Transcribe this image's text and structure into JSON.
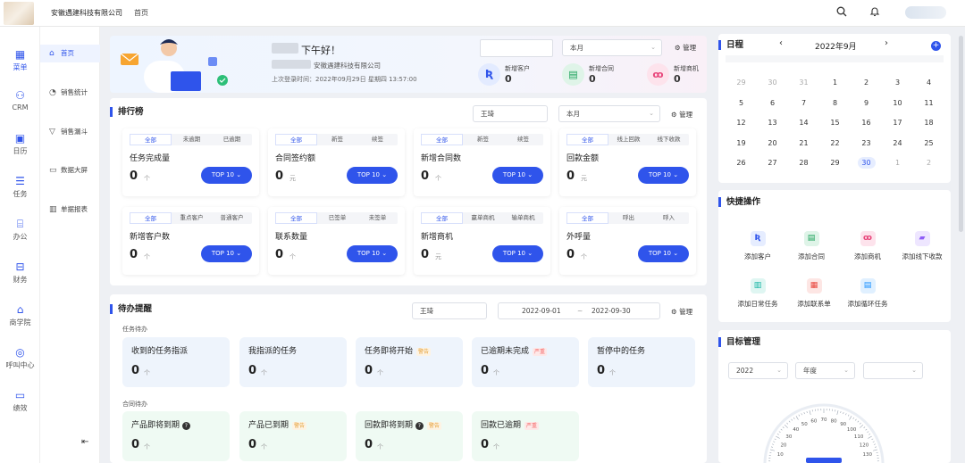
{
  "header": {
    "company": "安徽遇建科技有限公司",
    "breadcrumb": "首页"
  },
  "nav_primary": [
    {
      "label": "菜单",
      "icon": "grid-icon",
      "active": true
    },
    {
      "label": "CRM",
      "icon": "users-icon"
    },
    {
      "label": "日历",
      "icon": "calendar-icon"
    },
    {
      "label": "任务",
      "icon": "task-icon"
    },
    {
      "label": "办公",
      "icon": "office-icon"
    },
    {
      "label": "财务",
      "icon": "finance-icon"
    },
    {
      "label": "商学院",
      "icon": "academy-icon"
    },
    {
      "label": "呼叫中心",
      "icon": "callcenter-icon"
    },
    {
      "label": "绩效",
      "icon": "performance-icon"
    }
  ],
  "nav_secondary": [
    {
      "label": "首页",
      "icon": "home-icon",
      "active": true
    },
    {
      "label": "销售统计",
      "icon": "stats-icon"
    },
    {
      "label": "销售漏斗",
      "icon": "funnel-icon"
    },
    {
      "label": "数据大屏",
      "icon": "screen-icon"
    },
    {
      "label": "单据报表",
      "icon": "report-icon"
    }
  ],
  "welcome": {
    "greeting": "下午好！",
    "company": "安徽遇建科技有限公司",
    "last_login": "上次登录时间：2022年09月29日 星期四 13:57:00",
    "period": "本月",
    "manage": "管理",
    "stats": [
      {
        "label": "新增客户",
        "value": "0",
        "icon": "customer-icon",
        "color": "#2f54eb",
        "bg": "#e3ebff"
      },
      {
        "label": "新增合同",
        "value": "0",
        "icon": "contract-icon",
        "color": "#18a058",
        "bg": "#dff4e8"
      },
      {
        "label": "新增商机",
        "value": "0",
        "icon": "opportunity-icon",
        "color": "#e8457a",
        "bg": "#fde3ec"
      }
    ]
  },
  "ranking": {
    "title": "排行榜",
    "person": "王琦",
    "period": "本月",
    "manage": "管理",
    "top_label": "TOP 10",
    "cards": [
      {
        "tabs": [
          "全部",
          "未逾期",
          "已逾期"
        ],
        "title": "任务完成量",
        "value": "0",
        "unit": "个"
      },
      {
        "tabs": [
          "全部",
          "新签",
          "续签"
        ],
        "title": "合同签约额",
        "value": "0",
        "unit": "元"
      },
      {
        "tabs": [
          "全部",
          "新签",
          "续签"
        ],
        "title": "新增合同数",
        "value": "0",
        "unit": "个"
      },
      {
        "tabs": [
          "全部",
          "线上回款",
          "线下收款"
        ],
        "title": "回款金额",
        "value": "0",
        "unit": "元"
      },
      {
        "tabs": [
          "全部",
          "重点客户",
          "普通客户"
        ],
        "title": "新增客户数",
        "value": "0",
        "unit": "个"
      },
      {
        "tabs": [
          "全部",
          "已签单",
          "未签单"
        ],
        "title": "联系数量",
        "value": "0",
        "unit": "个"
      },
      {
        "tabs": [
          "全部",
          "赢单商机",
          "输单商机"
        ],
        "title": "新增商机",
        "value": "0",
        "unit": "元"
      },
      {
        "tabs": [
          "全部",
          "呼出",
          "呼入"
        ],
        "title": "外呼量",
        "value": "0",
        "unit": "个"
      }
    ]
  },
  "todo": {
    "title": "待办提醒",
    "person": "王琦",
    "date_from": "2022-09-01",
    "date_sep": "~",
    "date_to": "2022-09-30",
    "manage": "管理",
    "task_group": "任务待办",
    "contract_group": "合同待办",
    "tasks": [
      {
        "title": "收到的任务指派",
        "value": "0",
        "unit": "个",
        "tag": ""
      },
      {
        "title": "我指派的任务",
        "value": "0",
        "unit": "个",
        "tag": ""
      },
      {
        "title": "任务即将开始",
        "value": "0",
        "unit": "个",
        "tag": "警告",
        "tag_type": "w"
      },
      {
        "title": "已逾期未完成",
        "value": "0",
        "unit": "个",
        "tag": "严重",
        "tag_type": "s"
      },
      {
        "title": "暂停中的任务",
        "value": "0",
        "unit": "个",
        "tag": ""
      }
    ],
    "contracts": [
      {
        "title": "产品即将到期",
        "value": "0",
        "unit": "个",
        "tag": "",
        "help": true
      },
      {
        "title": "产品已到期",
        "value": "0",
        "unit": "个",
        "tag": "警告",
        "tag_type": "w"
      },
      {
        "title": "回款即将到期",
        "value": "0",
        "unit": "个",
        "tag": "警告",
        "tag_type": "w",
        "help": true
      },
      {
        "title": "回款已逾期",
        "value": "0",
        "unit": "个",
        "tag": "严重",
        "tag_type": "s"
      }
    ]
  },
  "calendar": {
    "title": "日程",
    "month": "2022年9月",
    "weeks": [
      [
        "29",
        "30",
        "31",
        "1",
        "2",
        "3",
        "4"
      ],
      [
        "5",
        "6",
        "7",
        "8",
        "9",
        "10",
        "11"
      ],
      [
        "12",
        "13",
        "14",
        "15",
        "16",
        "17",
        "18"
      ],
      [
        "19",
        "20",
        "21",
        "22",
        "23",
        "24",
        "25"
      ],
      [
        "26",
        "27",
        "28",
        "29",
        "30",
        "1",
        "2"
      ]
    ],
    "today": "30"
  },
  "quick": {
    "title": "快捷操作",
    "items": [
      {
        "label": "添加客户",
        "icon": "customer-icon",
        "color": "#2f54eb",
        "bg": "#e6edff"
      },
      {
        "label": "添加合同",
        "icon": "contract-icon",
        "color": "#18a058",
        "bg": "#dff4e8"
      },
      {
        "label": "添加商机",
        "icon": "opportunity-icon",
        "color": "#e8457a",
        "bg": "#fde3ec"
      },
      {
        "label": "添加线下收款",
        "icon": "wallet-icon",
        "color": "#8e5cf7",
        "bg": "#eee6ff"
      },
      {
        "label": "添加日常任务",
        "icon": "daily-task-icon",
        "color": "#12b5a3",
        "bg": "#dff6f2"
      },
      {
        "label": "添加联系单",
        "icon": "order-icon",
        "color": "#e8453c",
        "bg": "#fde6e4"
      },
      {
        "label": "添加循环任务",
        "icon": "loop-task-icon",
        "color": "#1890ff",
        "bg": "#e0f0ff"
      }
    ]
  },
  "goals": {
    "title": "目标管理",
    "year": "2022",
    "period": "年度",
    "gauge_ticks": [
      "10",
      "20",
      "30",
      "40",
      "50",
      "60",
      "70",
      "80",
      "90",
      "100",
      "110",
      "120",
      "130"
    ]
  }
}
